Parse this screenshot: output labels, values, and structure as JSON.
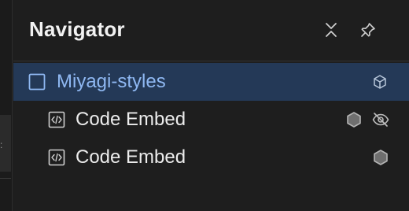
{
  "navigator": {
    "title": "Navigator",
    "buttons": {
      "collapse_icon": "collapse-icon",
      "pin_icon": "pin-icon"
    },
    "items": [
      {
        "label": "Miyagi-styles",
        "icon": "body-square-icon",
        "selected": true,
        "trailing": [
          "component-cube-icon"
        ]
      },
      {
        "label": "Code Embed",
        "icon": "code-embed-icon",
        "selected": false,
        "trailing": [
          "hexagon-icon",
          "eye-off-icon"
        ]
      },
      {
        "label": "Code Embed",
        "icon": "code-embed-icon",
        "selected": false,
        "trailing": [
          "hexagon-icon"
        ]
      }
    ]
  },
  "colors": {
    "background": "#1e1e1e",
    "selected_row": "#243957",
    "selected_text": "#8fb8f2",
    "text": "#ececec"
  }
}
